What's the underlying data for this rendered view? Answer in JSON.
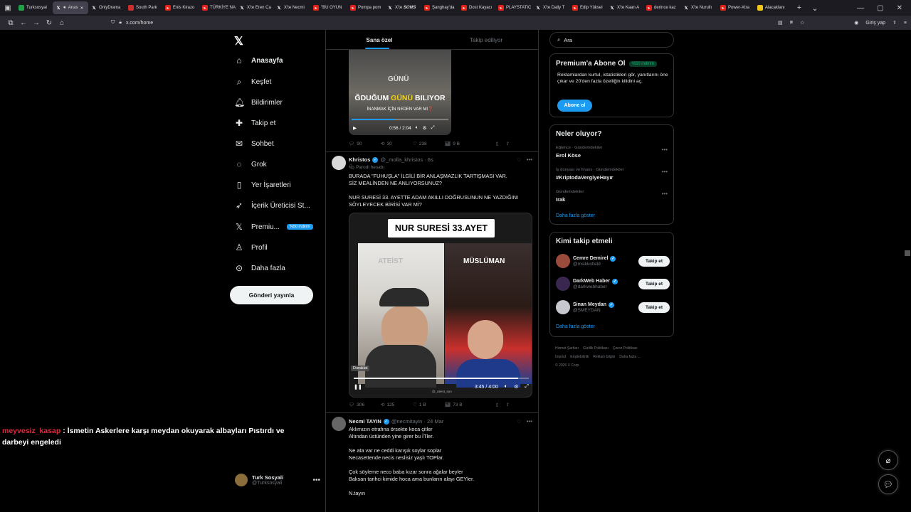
{
  "browser": {
    "tabs": [
      {
        "label": "Turksosyal",
        "fav": "g"
      },
      {
        "label": "Anas",
        "fav": "x",
        "active": true
      },
      {
        "label": "OnlyDrama",
        "fav": "x"
      },
      {
        "label": "South Park",
        "fav": "r"
      },
      {
        "label": "Enis Kirazo",
        "fav": "yt"
      },
      {
        "label": "TÜRKİYE NA",
        "fav": "yt"
      },
      {
        "label": "X'te Eren Ca",
        "fav": "x"
      },
      {
        "label": "X'te Necmi",
        "fav": "x"
      },
      {
        "label": "\"BU OYUN",
        "fav": "yt"
      },
      {
        "label": "Pompa pom",
        "fav": "yt"
      },
      {
        "label": "X'te 𝑺𝑶𝑵𝑺",
        "fav": "x"
      },
      {
        "label": "Şanghay'da",
        "fav": "yt"
      },
      {
        "label": "Dost Kayacı",
        "fav": "yt"
      },
      {
        "label": "PLAYSTATIC",
        "fav": "yt"
      },
      {
        "label": "X'te Daily T",
        "fav": "x"
      },
      {
        "label": "Edip Yüksel",
        "fav": "yt"
      },
      {
        "label": "X'te Kaan A",
        "fav": "x"
      },
      {
        "label": "derince kaz",
        "fav": "yt"
      },
      {
        "label": "X'te Nurullı",
        "fav": "x"
      },
      {
        "label": "Power-Xtra",
        "fav": "yt"
      },
      {
        "label": "Alacaklanı",
        "fav": "y"
      }
    ],
    "url": "x.com/home",
    "signin_label": "Giriş yap"
  },
  "sidebar": {
    "nav": [
      {
        "id": "home",
        "label": "Anasayfa",
        "icon": "⌂",
        "bold": true
      },
      {
        "id": "explore",
        "label": "Keşfet",
        "icon": "⌕"
      },
      {
        "id": "notifications",
        "label": "Bildirimler",
        "icon": "🔔︎"
      },
      {
        "id": "follow",
        "label": "Takip et",
        "icon": "✚"
      },
      {
        "id": "chat",
        "label": "Sohbet",
        "icon": "✉"
      },
      {
        "id": "grok",
        "label": "Grok",
        "icon": "◌"
      },
      {
        "id": "bookmarks",
        "label": "Yer İşaretleri",
        "icon": "▯"
      },
      {
        "id": "creator",
        "label": "İçerik Üreticisi St...",
        "icon": "➶"
      },
      {
        "id": "premium",
        "label": "Premiu...",
        "icon": "𝕏",
        "badge": "%50 indirim"
      },
      {
        "id": "profile",
        "label": "Profil",
        "icon": "♙"
      },
      {
        "id": "more",
        "label": "Daha fazla",
        "icon": "⊙"
      }
    ],
    "post_button": "Gönderi yayınla",
    "account": {
      "name": "Turk Sosyali",
      "handle": "@Turksosyali"
    }
  },
  "feed": {
    "tabs": [
      "Sana özel",
      "Takip ediliyor"
    ],
    "video1": {
      "word": "GÜNÜ",
      "caption_a": "ĞDUĞUM ",
      "caption_hl": "GÜNÜ",
      "caption_b": " BILIYOR",
      "caption2": "İNANMAK İÇİN NEDEN VAR MI❓",
      "time": "0:56 / 2:04",
      "progress": 0.45
    },
    "post1_actions": {
      "replies": "90",
      "reposts": "30",
      "likes": "238",
      "views": "9 B"
    },
    "post2": {
      "name": "Khristos",
      "handle": "@_molla_khristos · 6s",
      "parody": "Parodi hesabı",
      "text": "BURADA \"FUHUŞLA\" İLGİLİ BİR ANLAŞMAZLIK TARTIŞMASI VAR.\nSİZ MEALİNDEN NE ANLIYORSUNUZ?\n\nNUR SURESİ 33. AYETTE ADAM AKILLI DOĞRUSUNUN NE YAZDIĞINI SÖYLEYECEK BİRİSİ VAR Mİ?",
      "video_title": "NUR SURESİ 33.AYET",
      "left_label": "ATEİST",
      "right_label": "MÜSLÜMAN",
      "pause_tip": "Duraklat",
      "time": "3:45 / 4:00",
      "progress": 0.94,
      "watermark": "@_ateist_sarı",
      "actions": {
        "replies": "306",
        "reposts": "125",
        "likes": "1 B",
        "views": "73 B"
      }
    },
    "post3": {
      "name": "Necmi TAYIN",
      "handle": "@necmitayin · 24 Mar",
      "text": "Aklımızın etrafına örsekte koca çitler\nAltından üstünden yine girer bu İTler.\n\nNe ata var ne ceddi karışık soylar soplar\nNecasettende necis neslisiz yaşlı TOPlar.\n\nÇok söyleme neco baba kızar sonra ağalar beyler\nBaksan tarihci kimide hoca ama bunların alayı GEYler.\n\nN.tayın"
    }
  },
  "rail": {
    "search_placeholder": "Ara",
    "premium": {
      "title": "Premium'a Abone Ol",
      "badge": "%50 indirim",
      "text": "Reklamlardan kurtul, istatistikleri gör, yanıtlarını öne çıkar ve 20'den fazla özelliğin kilidini aç.",
      "button": "Abone ol"
    },
    "trends": {
      "title": "Neler oluyor?",
      "items": [
        {
          "category": "Eğlence · Gündemdekiler",
          "name": "Erol Köse"
        },
        {
          "category": "İş dünyası ve finans · Gündemdekiler",
          "name": "#KriptodaVergiyeHayır"
        },
        {
          "category": "Gündemdekiler",
          "name": "Irak"
        }
      ],
      "more": "Daha fazla göster"
    },
    "who": {
      "title": "Kimi takip etmeli",
      "items": [
        {
          "name": "Cemre Demirel",
          "handle": "@msikkofield",
          "button": "Takip et"
        },
        {
          "name": "DarkWeb Haber",
          "handle": "@darkwebhaber",
          "button": "Takip et"
        },
        {
          "name": "Sinan Meydan",
          "handle": "@SMEYDAN",
          "button": "Takip et"
        }
      ],
      "more": "Daha fazla göster"
    },
    "footer": [
      "Hizmet Şartları",
      "Gizlilik Politikası",
      "Çerez Politikası",
      "Imprint",
      "Erişilebilirlik",
      "Reklam bilgisi",
      "Daha fazla ...",
      "© 2026 X Corp."
    ]
  },
  "overlay": {
    "chat_user": "meyvesiz_kasap",
    "chat_text": " : İsmetin Askerlere karşı meydan okuyarak albayları Pıstırdı ve darbeyi engeledi"
  }
}
